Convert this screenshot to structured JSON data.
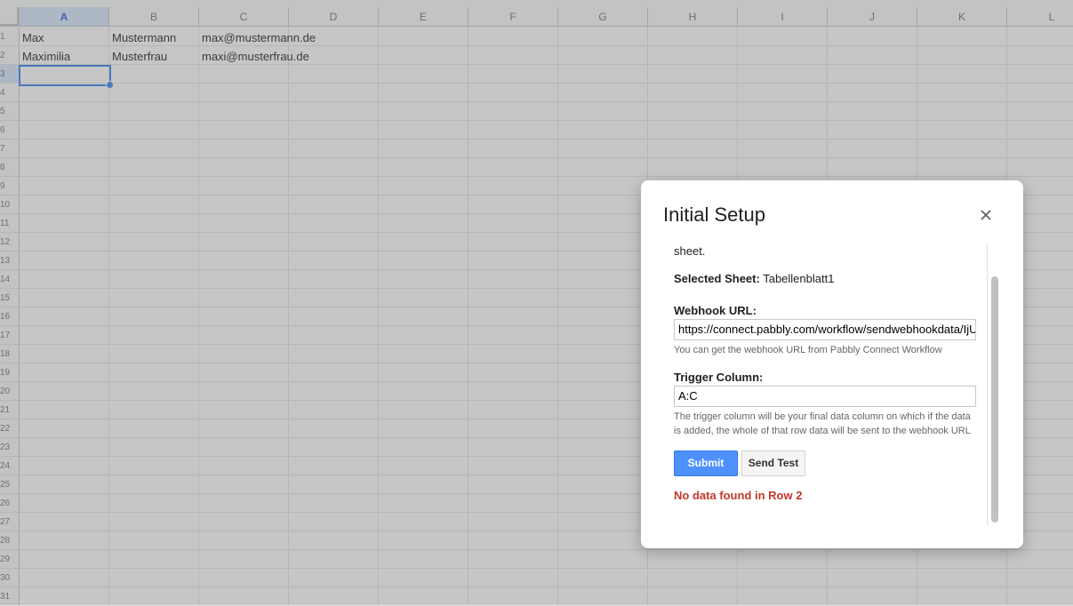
{
  "sheet": {
    "columns": [
      "A",
      "B",
      "C",
      "D",
      "E",
      "F",
      "G",
      "H",
      "I",
      "J",
      "K",
      "L"
    ],
    "selected_column": "A",
    "row_labels": [
      "1",
      "2",
      "3",
      "4",
      "5",
      "6",
      "7",
      "8",
      "9",
      "10",
      "11",
      "12",
      "13",
      "14",
      "15",
      "16",
      "17",
      "18",
      "19",
      "20",
      "21",
      "22",
      "23",
      "24",
      "25",
      "26",
      "27",
      "28",
      "29",
      "30",
      "31"
    ],
    "selected_row": "3",
    "rows": [
      [
        "Max",
        "Mustermann",
        "max@mustermann.de"
      ],
      [
        "Maximilia",
        "Musterfrau",
        "maxi@musterfrau.de"
      ]
    ]
  },
  "dialog": {
    "title": "Initial Setup",
    "close_icon": "close-icon",
    "intro_tail": "sheet.",
    "selected_sheet_label": "Selected Sheet:",
    "selected_sheet_value": "Tabellenblatt1",
    "webhook_label": "Webhook URL:",
    "webhook_value": "https://connect.pabbly.com/workflow/sendwebhookdata/IjU",
    "webhook_hint": "You can get the webhook URL from Pabbly Connect Workflow",
    "trigger_label": "Trigger Column:",
    "trigger_value": "A:C",
    "trigger_hint": "The trigger column will be your final data column on which if the data is added, the whole of that row data will be sent to the webhook URL",
    "submit_label": "Submit",
    "send_test_label": "Send Test",
    "error_message": "No data found in Row 2"
  },
  "colors": {
    "accent": "#1a73e8",
    "submit_bg": "#4d90fe",
    "error": "#c5372c"
  }
}
